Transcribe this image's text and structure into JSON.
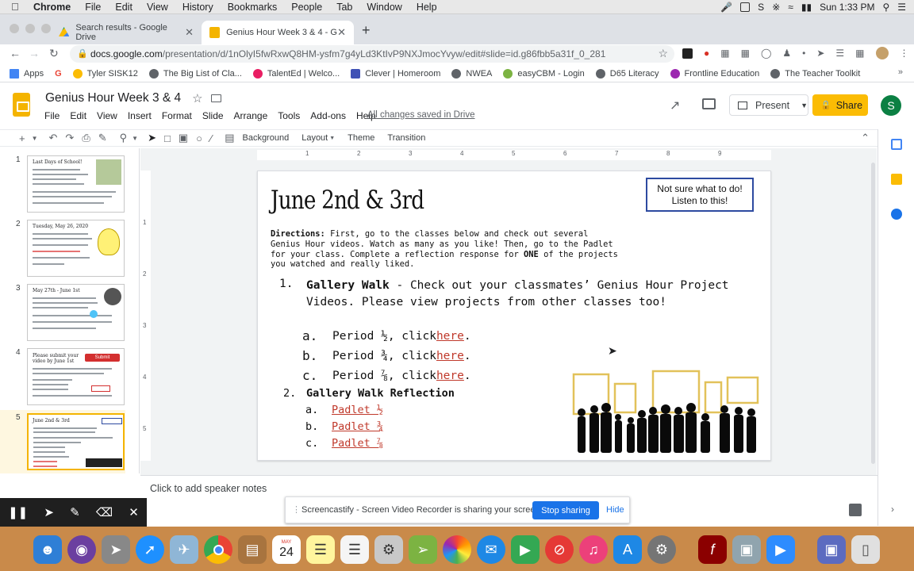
{
  "mac_menubar": {
    "app": "Chrome",
    "menus": [
      "File",
      "Edit",
      "View",
      "History",
      "Bookmarks",
      "People",
      "Tab",
      "Window",
      "Help"
    ],
    "clock": "Sun 1:33 PM"
  },
  "browser": {
    "tabs": [
      {
        "label": "Search results - Google Drive",
        "active": false
      },
      {
        "label": "Genius Hour Week 3 & 4 - Goo",
        "active": true
      }
    ],
    "new_tab": "+",
    "url_host": "docs.google.com",
    "url_path": "/presentation/d/1nOlyI5fwRxwQ8HM-ysfm7g4yLd3KtIvP9NXJmocYvyw/edit#slide=id.g86fbb5a31f_0_281",
    "bookmarks": [
      {
        "label": "Apps",
        "color": "#4285f4"
      },
      {
        "label": "G",
        "color": "#ea4335"
      },
      {
        "label": "Tyler SISK12",
        "color": "#fbbc04"
      },
      {
        "label": "The Big List of Cla...",
        "color": "#5f6368"
      },
      {
        "label": "TalentEd | Welco...",
        "color": "#e91e63"
      },
      {
        "label": "Clever | Homeroom",
        "color": "#3f51b5"
      },
      {
        "label": "NWEA",
        "color": "#5f6368"
      },
      {
        "label": "easyCBM - Login",
        "color": "#7cb342"
      },
      {
        "label": "D65 Literacy",
        "color": "#5f6368"
      },
      {
        "label": "Frontline Education",
        "color": "#9c27b0"
      },
      {
        "label": "The Teacher Toolkit",
        "color": "#5f6368"
      }
    ]
  },
  "slides_app": {
    "title": "Genius Hour Week 3 & 4",
    "menu": [
      "File",
      "Edit",
      "View",
      "Insert",
      "Format",
      "Slide",
      "Arrange",
      "Tools",
      "Add-ons",
      "Help"
    ],
    "saved_status": "All changes saved in Drive",
    "present_label": "Present",
    "share_label": "Share",
    "avatar_letter": "S",
    "toolbar": {
      "background": "Background",
      "layout": "Layout",
      "theme": "Theme",
      "transition": "Transition"
    },
    "slide_numbers": [
      "1",
      "2",
      "3",
      "4",
      "5"
    ],
    "ruler_top": [
      "1",
      "2",
      "3",
      "4",
      "5",
      "6",
      "7",
      "8",
      "9"
    ],
    "ruler_left": [
      "1",
      "2",
      "3",
      "4",
      "5"
    ],
    "notes_placeholder": "Click to add speaker notes"
  },
  "thumbnails": [
    {
      "title": "Last Days of School!"
    },
    {
      "title": "Tuesday, May 26, 2020"
    },
    {
      "title": "May 27th - June 1st"
    },
    {
      "title": "Please submit your video by June 1st",
      "badge": "Submit"
    },
    {
      "title": "June 2nd & 3rd"
    }
  ],
  "slide": {
    "title": "June 2nd & 3rd",
    "callout": "Not sure what to do! Listen to this!",
    "directions_label": "Directions:",
    "directions_text_1": " First, go to the classes below and check out several Genius Hour videos.  Watch as many as you like!  Then, go to the Padlet for your class.  Complete a reflection response for ",
    "directions_bold": "ONE",
    "directions_text_2": " of the projects you watched and really liked.",
    "item1_num": "1.",
    "item1_bold": "Gallery Walk",
    "item1_rest": " - Check out your classmates’ Genius Hour Project Videos.  Please view projects from other classes too!",
    "sub1": [
      {
        "letter": "a.",
        "text": "Period ½, click ",
        "link": "here",
        "end": "."
      },
      {
        "letter": "b.",
        "text": "Period ¾, click ",
        "link": "here",
        "end": "."
      },
      {
        "letter": "c.",
        "text": "Period ⅞, click ",
        "link": "here",
        "end": "."
      }
    ],
    "item2_num": "2.",
    "item2_bold": "Gallery Walk Reflection",
    "sub2": [
      {
        "letter": "a.",
        "link": "Padlet ½"
      },
      {
        "letter": "b.",
        "link": "Padlet ¾"
      },
      {
        "letter": "c.",
        "link": "Padlet ⅞"
      }
    ]
  },
  "screencastify": {
    "message": "Screencastify - Screen Video Recorder is sharing your screen.",
    "stop_label": "Stop sharing",
    "hide_label": "Hide"
  },
  "dock": {
    "calendar_month": "MAY",
    "calendar_day": "24"
  },
  "colors": {
    "slides_yellow": "#f4b400",
    "share_yellow": "#fbbc04",
    "link_red": "#c0392b",
    "callout_border": "#2d4aa0",
    "stop_blue": "#1a73e8"
  }
}
